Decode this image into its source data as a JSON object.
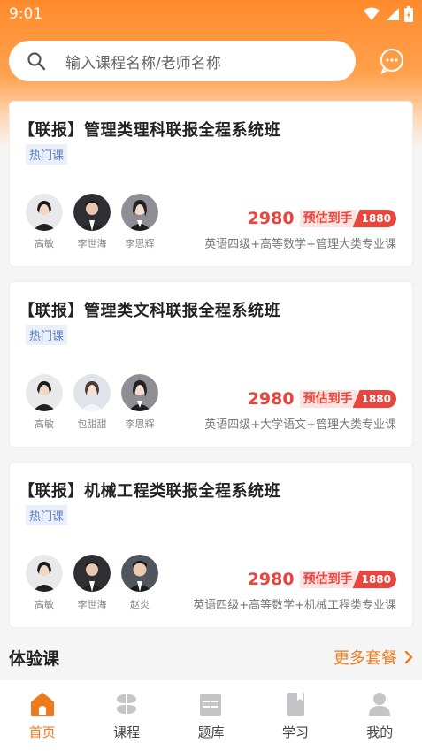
{
  "status_bar": {
    "time": "9:01"
  },
  "search": {
    "placeholder": "输入课程名称/老师名称"
  },
  "colors": {
    "accent": "#f07a1b",
    "price": "#e8453c",
    "tag_bg": "#eaf0fb"
  },
  "courses": [
    {
      "title": "【联报】管理类理科联报全程系统班",
      "tag": "热门课",
      "teachers": [
        "高敏",
        "李世海",
        "李思辉"
      ],
      "price": "2980",
      "est_label": "预估到手",
      "est_value": "1880",
      "subjects": "英语四级+高等数学+管理大类专业课"
    },
    {
      "title": "【联报】管理类文科联报全程系统班",
      "tag": "热门课",
      "teachers": [
        "高敏",
        "包甜甜",
        "李思辉"
      ],
      "price": "2980",
      "est_label": "预估到手",
      "est_value": "1880",
      "subjects": "英语四级+大学语文+管理大类专业课"
    },
    {
      "title": "【联报】机械工程类联报全程系统班",
      "tag": "热门课",
      "teachers": [
        "高敏",
        "李世海",
        "赵炎"
      ],
      "price": "2980",
      "est_label": "预估到手",
      "est_value": "1880",
      "subjects": "英语四级+高等数学+机械工程类专业课"
    }
  ],
  "section": {
    "title": "体验课",
    "more": "更多套餐"
  },
  "tabs": [
    {
      "label": "首页",
      "icon": "home-icon",
      "active": true
    },
    {
      "label": "课程",
      "icon": "course-icon",
      "active": false
    },
    {
      "label": "题库",
      "icon": "question-bank-icon",
      "active": false
    },
    {
      "label": "学习",
      "icon": "study-icon",
      "active": false
    },
    {
      "label": "我的",
      "icon": "profile-icon",
      "active": false
    }
  ]
}
